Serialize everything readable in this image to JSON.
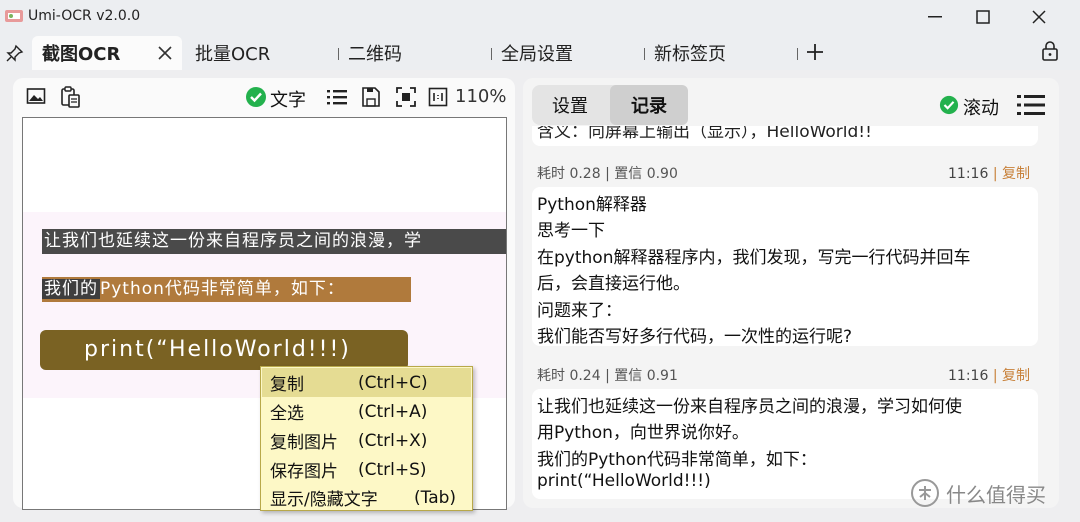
{
  "window": {
    "title": "Umi-OCR v2.0.0"
  },
  "tabs": [
    {
      "label": "截图OCR",
      "active": true
    },
    {
      "label": "批量OCR"
    },
    {
      "label": "二维码"
    },
    {
      "label": "全局设置"
    },
    {
      "label": "新标签页"
    }
  ],
  "toolbar": {
    "text_toggle_label": "文字",
    "zoom": "110%"
  },
  "image_text": {
    "line1": "让我们也延续这一份来自程序员之间的浪漫，学",
    "line2_prefix": "我们的",
    "line2_rest": "Python代码非常简单，如下：",
    "code": "print(“HelloWorld!!!)"
  },
  "context_menu": [
    {
      "label": "复制",
      "shortcut": "(Ctrl+C)"
    },
    {
      "label": "全选",
      "shortcut": "(Ctrl+A)"
    },
    {
      "label": "复制图片",
      "shortcut": "(Ctrl+X)"
    },
    {
      "label": "保存图片",
      "shortcut": "(Ctrl+S)"
    },
    {
      "label": "显示/隐藏文字",
      "shortcut": "(Tab)"
    }
  ],
  "right": {
    "tabs": [
      {
        "label": "设置"
      },
      {
        "label": "记录",
        "active": true
      }
    ],
    "scroll_label": "滚动",
    "clipped_line": "含义：向屏幕上输出（显示），HelloWorld!!",
    "records": [
      {
        "meta": "耗时 0.28 | 置信 0.90",
        "time": "11:16",
        "sep": "|",
        "copy": "复制",
        "lines": [
          "Python解释器",
          "思考一下",
          "在python解释器程序内，我们发现，写完一行代码并回车",
          "后，会直接运行他。",
          "问题来了：",
          "我们能否写好多行代码，一次性的运行呢?"
        ]
      },
      {
        "meta": "耗时 0.24 | 置信 0.91",
        "time": "11:16",
        "sep": "|",
        "copy": "复制",
        "lines": [
          "让我们也延续这一份来自程序员之间的浪漫，学习如何使",
          "用Python，向世界说你好。",
          "我们的Python代码非常简单，如下：",
          "print(“HelloWorld!!!)"
        ]
      }
    ]
  },
  "watermark": "什么值得买",
  "colors": {
    "accent_green": "#23b14d",
    "copy_link": "#c8813a",
    "menu_bg": "#fdf8c6"
  }
}
